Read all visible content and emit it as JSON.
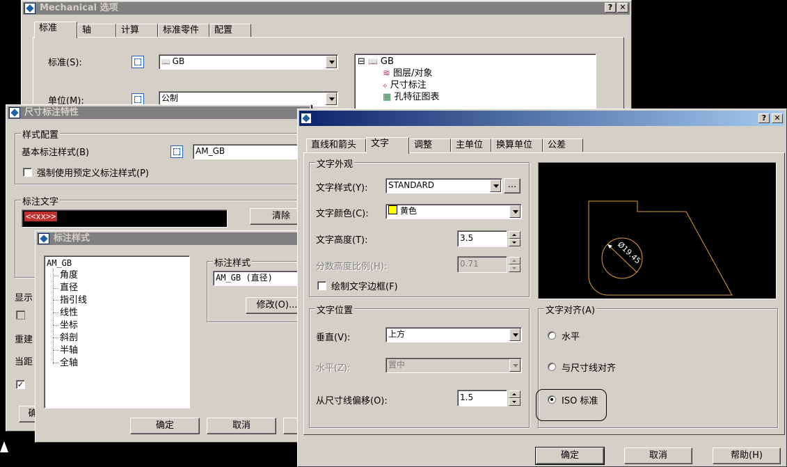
{
  "mech": {
    "title": "Mechanical 选项",
    "tabs": [
      "标准",
      "轴",
      "计算",
      "标准零件",
      "配置"
    ],
    "standard_label": "标准(S):",
    "standard_value": "GB",
    "unit_label": "单位(M):",
    "unit_value": "公制",
    "tree": {
      "root": "GB",
      "items": [
        "图层/对象",
        "尺寸标注",
        "孔特征图表"
      ]
    }
  },
  "dimprops": {
    "title": "尺寸标注特性",
    "style_group": "样式配置",
    "base_style_label": "基本标注样式(B)",
    "base_style_value": "AM_GB",
    "force_predefined_label": "强制使用预定义标注样式(P)",
    "text_group": "标注文字",
    "text_value": "<<xx>>",
    "clear_button": "清除",
    "partial_labels": [
      "显示",
      "重建",
      "当距"
    ],
    "partial_ok": "确"
  },
  "stylelist": {
    "title": "标注样式",
    "tree": {
      "root": "AM_GB",
      "children": [
        "角度",
        "直径",
        "指引线",
        "线性",
        "坐标",
        "斜剖",
        "半轴",
        "全轴"
      ]
    },
    "style_group": "标注样式",
    "style_value": "AM_GB (直径)",
    "modify_button": "修改(O)...",
    "ok_button": "确定",
    "cancel_button": "取消"
  },
  "textdlg": {
    "tabs": [
      "直线和箭头",
      "文字",
      "调整",
      "主单位",
      "换算单位",
      "公差"
    ],
    "appearance_group": "文字外观",
    "text_style_label": "文字样式(Y):",
    "text_style_value": "STANDARD",
    "browse_button": "...",
    "text_color_label": "文字颜色(C):",
    "text_color_value": "黄色",
    "text_color_swatch": "#ffff00",
    "text_height_label": "文字高度(T):",
    "text_height_value": "3.5",
    "fraction_scale_label": "分数高度比例(H):",
    "fraction_scale_value": "0.71",
    "draw_frame_label": "绘制文字边框(F)",
    "placement_group": "文字位置",
    "vertical_label": "垂直(V):",
    "vertical_value": "上方",
    "horizontal_label": "水平(Z):",
    "horizontal_value": "置中",
    "offset_label": "从尺寸线偏移(O):",
    "offset_value": "1.5",
    "alignment_group": "文字对齐(A)",
    "align_options": [
      "水平",
      "与尺寸线对齐",
      "ISO 标准"
    ],
    "align_selected": 2,
    "preview_dim_text": "Ø19.45",
    "ok_button": "确定",
    "cancel_button": "取消",
    "help_button": "帮助(H)"
  },
  "colors": {
    "preview_line": "#e0a040",
    "preview_bg": "#000000"
  }
}
